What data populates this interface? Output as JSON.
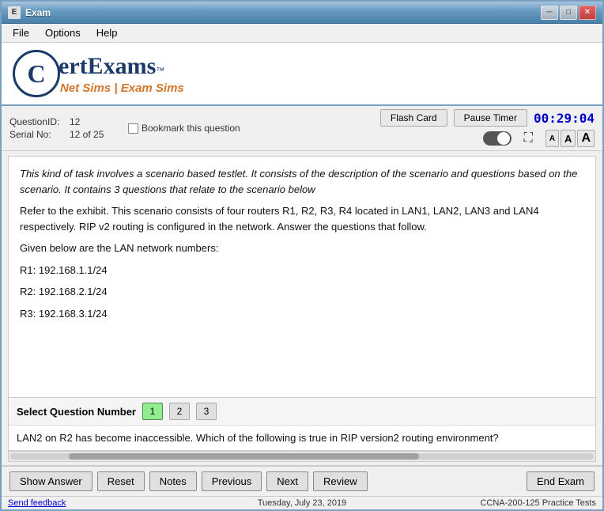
{
  "titlebar": {
    "title": "Exam",
    "icon": "E",
    "minimize": "─",
    "maximize": "□",
    "close": "✕"
  },
  "menubar": {
    "items": [
      "File",
      "Options",
      "Help"
    ]
  },
  "logo": {
    "letter": "C",
    "name": "ertExams",
    "tm": "™",
    "tagline": "Net Sims | Exam Sims"
  },
  "question_header": {
    "question_id_label": "QuestionID:",
    "question_id_value": "12",
    "serial_no_label": "Serial No:",
    "serial_no_value": "12 of 25",
    "bookmark_label": "Bookmark this question",
    "flashcard_label": "Flash Card",
    "pause_label": "Pause Timer",
    "timer": "00:29:04",
    "font_small": "A",
    "font_medium": "A",
    "font_large": "A"
  },
  "question_content": {
    "intro": "This kind of task involves a scenario based testlet. It consists of the description of the scenario and questions based on the scenario. It contains 3 questions that relate to the scenario below",
    "body_lines": [
      "Refer to the exhibit. This scenario consists of four routers R1, R2, R3, R4 located in LAN1, LAN2, LAN3 and LAN4 respectively. RIP v2 routing is configured in the network. Answer the questions that follow.",
      "Given below are the LAN network numbers:",
      "R1: 192.168.1.1/24",
      "R2: 192.168.2.1/24",
      "R3: 192.168.3.1/24"
    ]
  },
  "select_question": {
    "label": "Select Question Number",
    "buttons": [
      {
        "num": "1",
        "active": true
      },
      {
        "num": "2",
        "active": false
      },
      {
        "num": "3",
        "active": false
      }
    ]
  },
  "question_text": "LAN2 on R2 has become inaccessible. Which of the following is true in RIP version2 routing environment?",
  "bottom_buttons": {
    "show_answer": "Show Answer",
    "reset": "Reset",
    "notes": "Notes",
    "previous": "Previous",
    "next": "Next",
    "review": "Review",
    "end_exam": "End Exam"
  },
  "statusbar": {
    "feedback": "Send feedback",
    "date": "Tuesday, July 23, 2019",
    "product": "CCNA-200-125 Practice Tests"
  }
}
